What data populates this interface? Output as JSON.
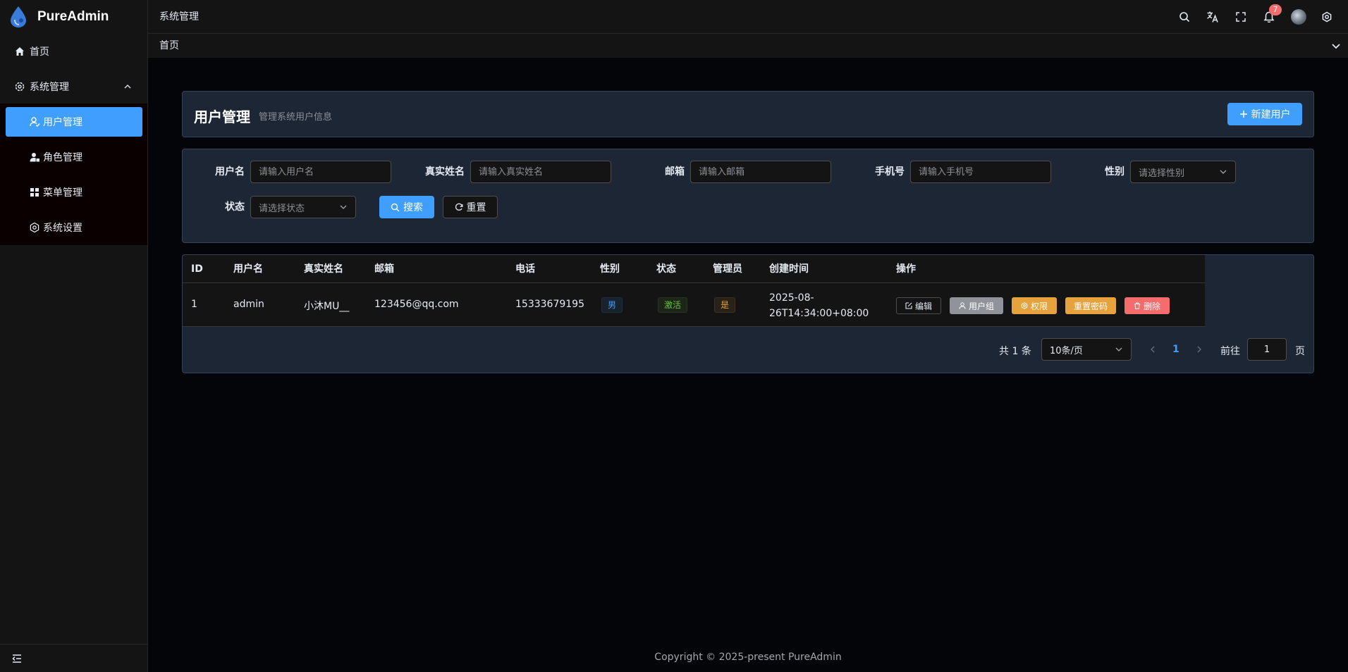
{
  "app": {
    "name": "PureAdmin"
  },
  "sidebar": {
    "items": [
      {
        "label": "首页",
        "icon": "home-icon"
      },
      {
        "label": "系统管理",
        "icon": "gear-icon"
      }
    ],
    "submenu": [
      {
        "label": "用户管理",
        "icon": "user-icon",
        "active": true
      },
      {
        "label": "角色管理",
        "icon": "role-icon"
      },
      {
        "label": "菜单管理",
        "icon": "grid-icon"
      },
      {
        "label": "系统设置",
        "icon": "settings-icon"
      }
    ]
  },
  "header": {
    "breadcrumb": "系统管理",
    "notification_count": "7"
  },
  "tagbar": {
    "home": "首页"
  },
  "page": {
    "title": "用户管理",
    "subtitle": "管理系统用户信息",
    "new_user_label": "新建用户"
  },
  "filters": {
    "username_label": "用户名",
    "username_placeholder": "请输入用户名",
    "realname_label": "真实姓名",
    "realname_placeholder": "请输入真实姓名",
    "email_label": "邮箱",
    "email_placeholder": "请输入邮箱",
    "phone_label": "手机号",
    "phone_placeholder": "请输入手机号",
    "gender_label": "性别",
    "gender_placeholder": "请选择性别",
    "status_label": "状态",
    "status_placeholder": "请选择状态",
    "search_label": "搜索",
    "reset_label": "重置"
  },
  "table": {
    "columns": [
      "ID",
      "用户名",
      "真实姓名",
      "邮箱",
      "电话",
      "性别",
      "状态",
      "管理员",
      "创建时间",
      "操作"
    ],
    "rows": [
      {
        "id": "1",
        "username": "admin",
        "realname": "小沐MU__",
        "email": "123456@qq.com",
        "phone": "15333679195",
        "gender": "男",
        "status": "激活",
        "admin": "是",
        "created_line1": "2025-08-",
        "created_line2": "26T14:34:00+08:00"
      }
    ],
    "actions": {
      "edit": "编辑",
      "group": "用户组",
      "perm": "权限",
      "reset_pwd": "重置密码",
      "delete": "删除"
    }
  },
  "pagination": {
    "total": "共 1 条",
    "page_size": "10条/页",
    "current": "1",
    "goto_label": "前往",
    "goto_value": "1",
    "page_suffix": "页"
  },
  "footer": {
    "copyright": "Copyright © 2025-present PureAdmin"
  },
  "colors": {
    "primary": "#409eff",
    "warning": "#e6a23c",
    "danger": "#f56c6c",
    "info": "#909399",
    "success": "#67c23a"
  }
}
